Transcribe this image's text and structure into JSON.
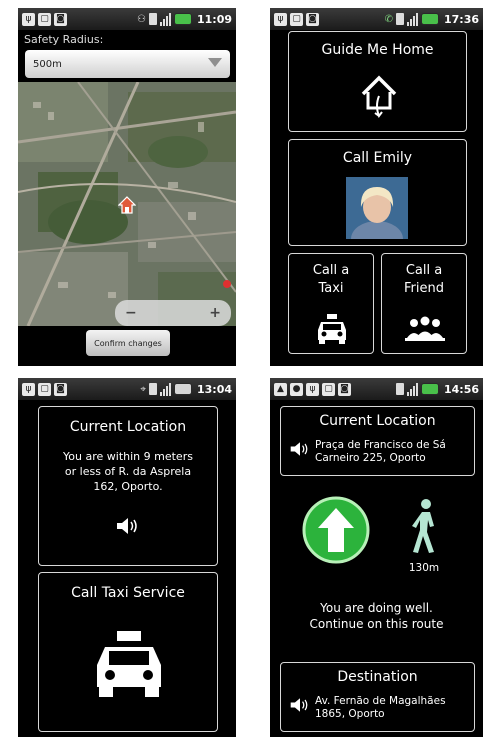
{
  "screens": {
    "map": {
      "status_time": "11:09",
      "safety_label": "Safety Radius:",
      "radius_value": "500m",
      "zoom_out": "−",
      "zoom_in": "+",
      "confirm_label": "Confirm changes"
    },
    "menu": {
      "status_time": "17:36",
      "guide_label": "Guide Me Home",
      "call_emily_label": "Call Emily",
      "call_taxi_label": "Call a Taxi",
      "call_friend_label": "Call a Friend"
    },
    "location": {
      "status_time": "13:04",
      "title": "Current Location",
      "description": "You are within 9 meters or less of R. da Asprela 162, Oporto.",
      "taxi_label": "Call Taxi Service"
    },
    "navigation": {
      "status_time": "14:56",
      "current_title": "Current Location",
      "current_address": "Praça de Francisco de Sá Carneiro 225, Oporto",
      "distance": "130m",
      "message": "You are doing well. Continue on this route",
      "destination_title": "Destination",
      "destination_address": "Av. Fernão de Magalhães 1865, Oporto"
    }
  },
  "colors": {
    "accent_green": "#2cb33c",
    "battery_green": "#49c04a",
    "border": "#d8d8d8",
    "walker": "#b6e6d3"
  }
}
